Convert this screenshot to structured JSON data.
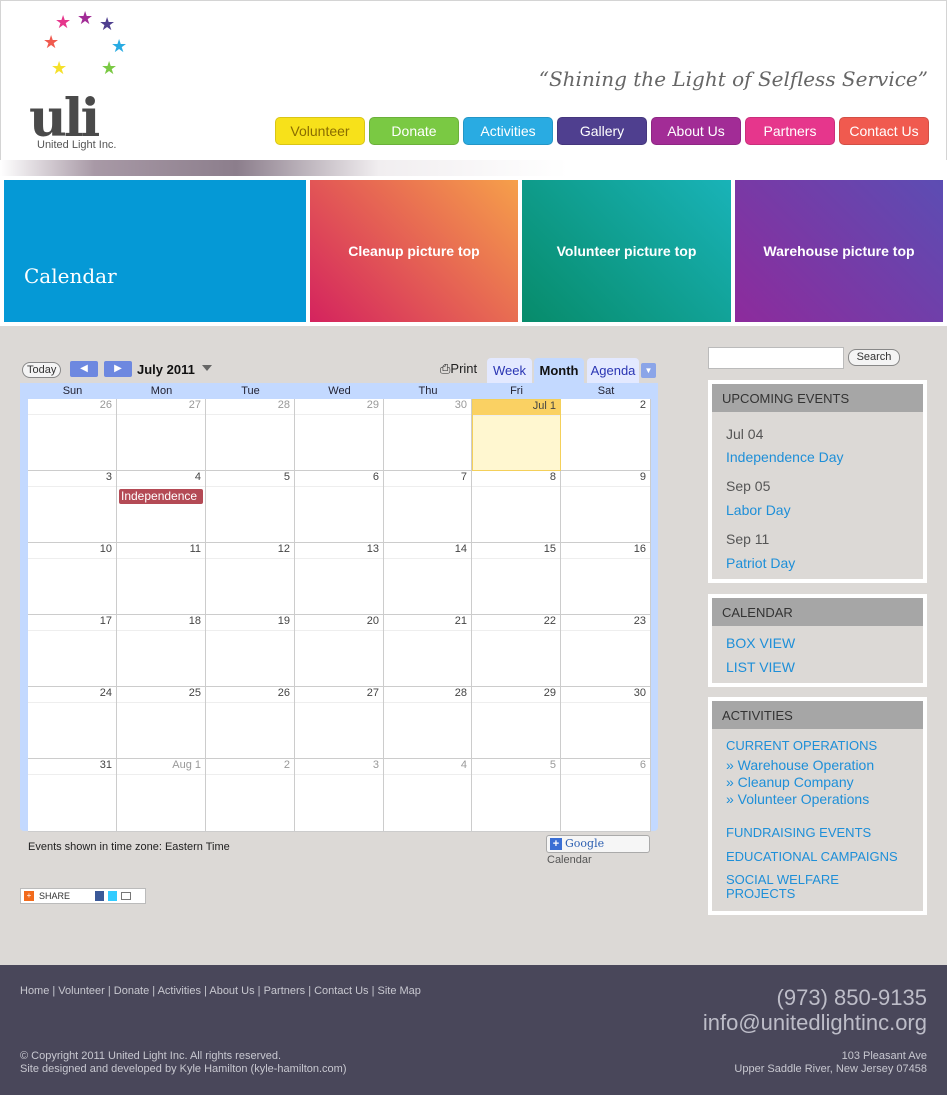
{
  "brand": {
    "logo_mark": "uli",
    "name": "United Light Inc.",
    "tagline": "“Shining the Light of Selfless Service”"
  },
  "nav": [
    {
      "label": "Volunteer",
      "color": "#f5e02a",
      "text": "#8a6d00"
    },
    {
      "label": "Donate",
      "color": "#7ac943",
      "text": "#ffffff"
    },
    {
      "label": "Activities",
      "color": "#29abe2",
      "text": "#ffffff"
    },
    {
      "label": "Gallery",
      "color": "#4f3f8f",
      "text": "#ffffff"
    },
    {
      "label": "About Us",
      "color": "#a22c96",
      "text": "#ffffff"
    },
    {
      "label": "Partners",
      "color": "#e6368c",
      "text": "#ffffff"
    },
    {
      "label": "Contact Us",
      "color": "#f05a4f",
      "text": "#ffffff"
    }
  ],
  "hero": {
    "title": "Calendar",
    "tiles": [
      {
        "label": "Cleanup picture top"
      },
      {
        "label": "Volunteer picture top"
      },
      {
        "label": "Warehouse picture top"
      }
    ]
  },
  "calendar": {
    "today_label": "Today",
    "prev": "◀",
    "next": "▶",
    "month_label": "July 2011",
    "print_label": "Print",
    "tabs": [
      "Week",
      "Month",
      "Agenda"
    ],
    "day_names": [
      "Sun",
      "Mon",
      "Tue",
      "Wed",
      "Thu",
      "Fri",
      "Sat"
    ],
    "weeks": [
      [
        "26",
        "27",
        "28",
        "29",
        "30",
        "Jul 1",
        "2"
      ],
      [
        "3",
        "4",
        "5",
        "6",
        "7",
        "8",
        "9"
      ],
      [
        "10",
        "11",
        "12",
        "13",
        "14",
        "15",
        "16"
      ],
      [
        "17",
        "18",
        "19",
        "20",
        "21",
        "22",
        "23"
      ],
      [
        "24",
        "25",
        "26",
        "27",
        "28",
        "29",
        "30"
      ],
      [
        "31",
        "Aug 1",
        "2",
        "3",
        "4",
        "5",
        "6"
      ]
    ],
    "event": {
      "label": "Independence"
    },
    "timezone": "Events shown in time zone: Eastern Time",
    "gcal_label": "Google",
    "gcal_sub": "Calendar"
  },
  "share": {
    "label": "SHARE"
  },
  "search": {
    "button": "Search",
    "placeholder": ""
  },
  "upcoming": {
    "heading": "UPCOMING EVENTS",
    "items": [
      {
        "date": "Jul 04",
        "name": "Independence Day"
      },
      {
        "date": "Sep 05",
        "name": "Labor Day"
      },
      {
        "date": "Sep 11",
        "name": "Patriot Day"
      }
    ]
  },
  "calendar_box": {
    "heading": "CALENDAR",
    "links": [
      "BOX VIEW",
      "LIST VIEW"
    ]
  },
  "activities": {
    "heading": "ACTIVITIES",
    "current": "CURRENT OPERATIONS",
    "sub": [
      "» Warehouse Operation",
      "» Cleanup Company",
      "» Volunteer Operations"
    ],
    "others": [
      "FUNDRAISING EVENTS",
      "EDUCATIONAL CAMPAIGNS",
      "SOCIAL WELFARE PROJECTS"
    ]
  },
  "footer": {
    "nav": "Home | Volunteer | Donate | Activities | About Us | Partners | Contact Us | Site Map",
    "phone": "(973) 850-9135",
    "email": "info@unitedlightinc.org",
    "copyright": "© Copyright 2011 United Light Inc. All rights reserved.",
    "credit": "Site designed and developed by Kyle Hamilton (kyle-hamilton.com)",
    "address1": "103 Pleasant Ave",
    "address2": "Upper Saddle River, New Jersey 07458"
  }
}
